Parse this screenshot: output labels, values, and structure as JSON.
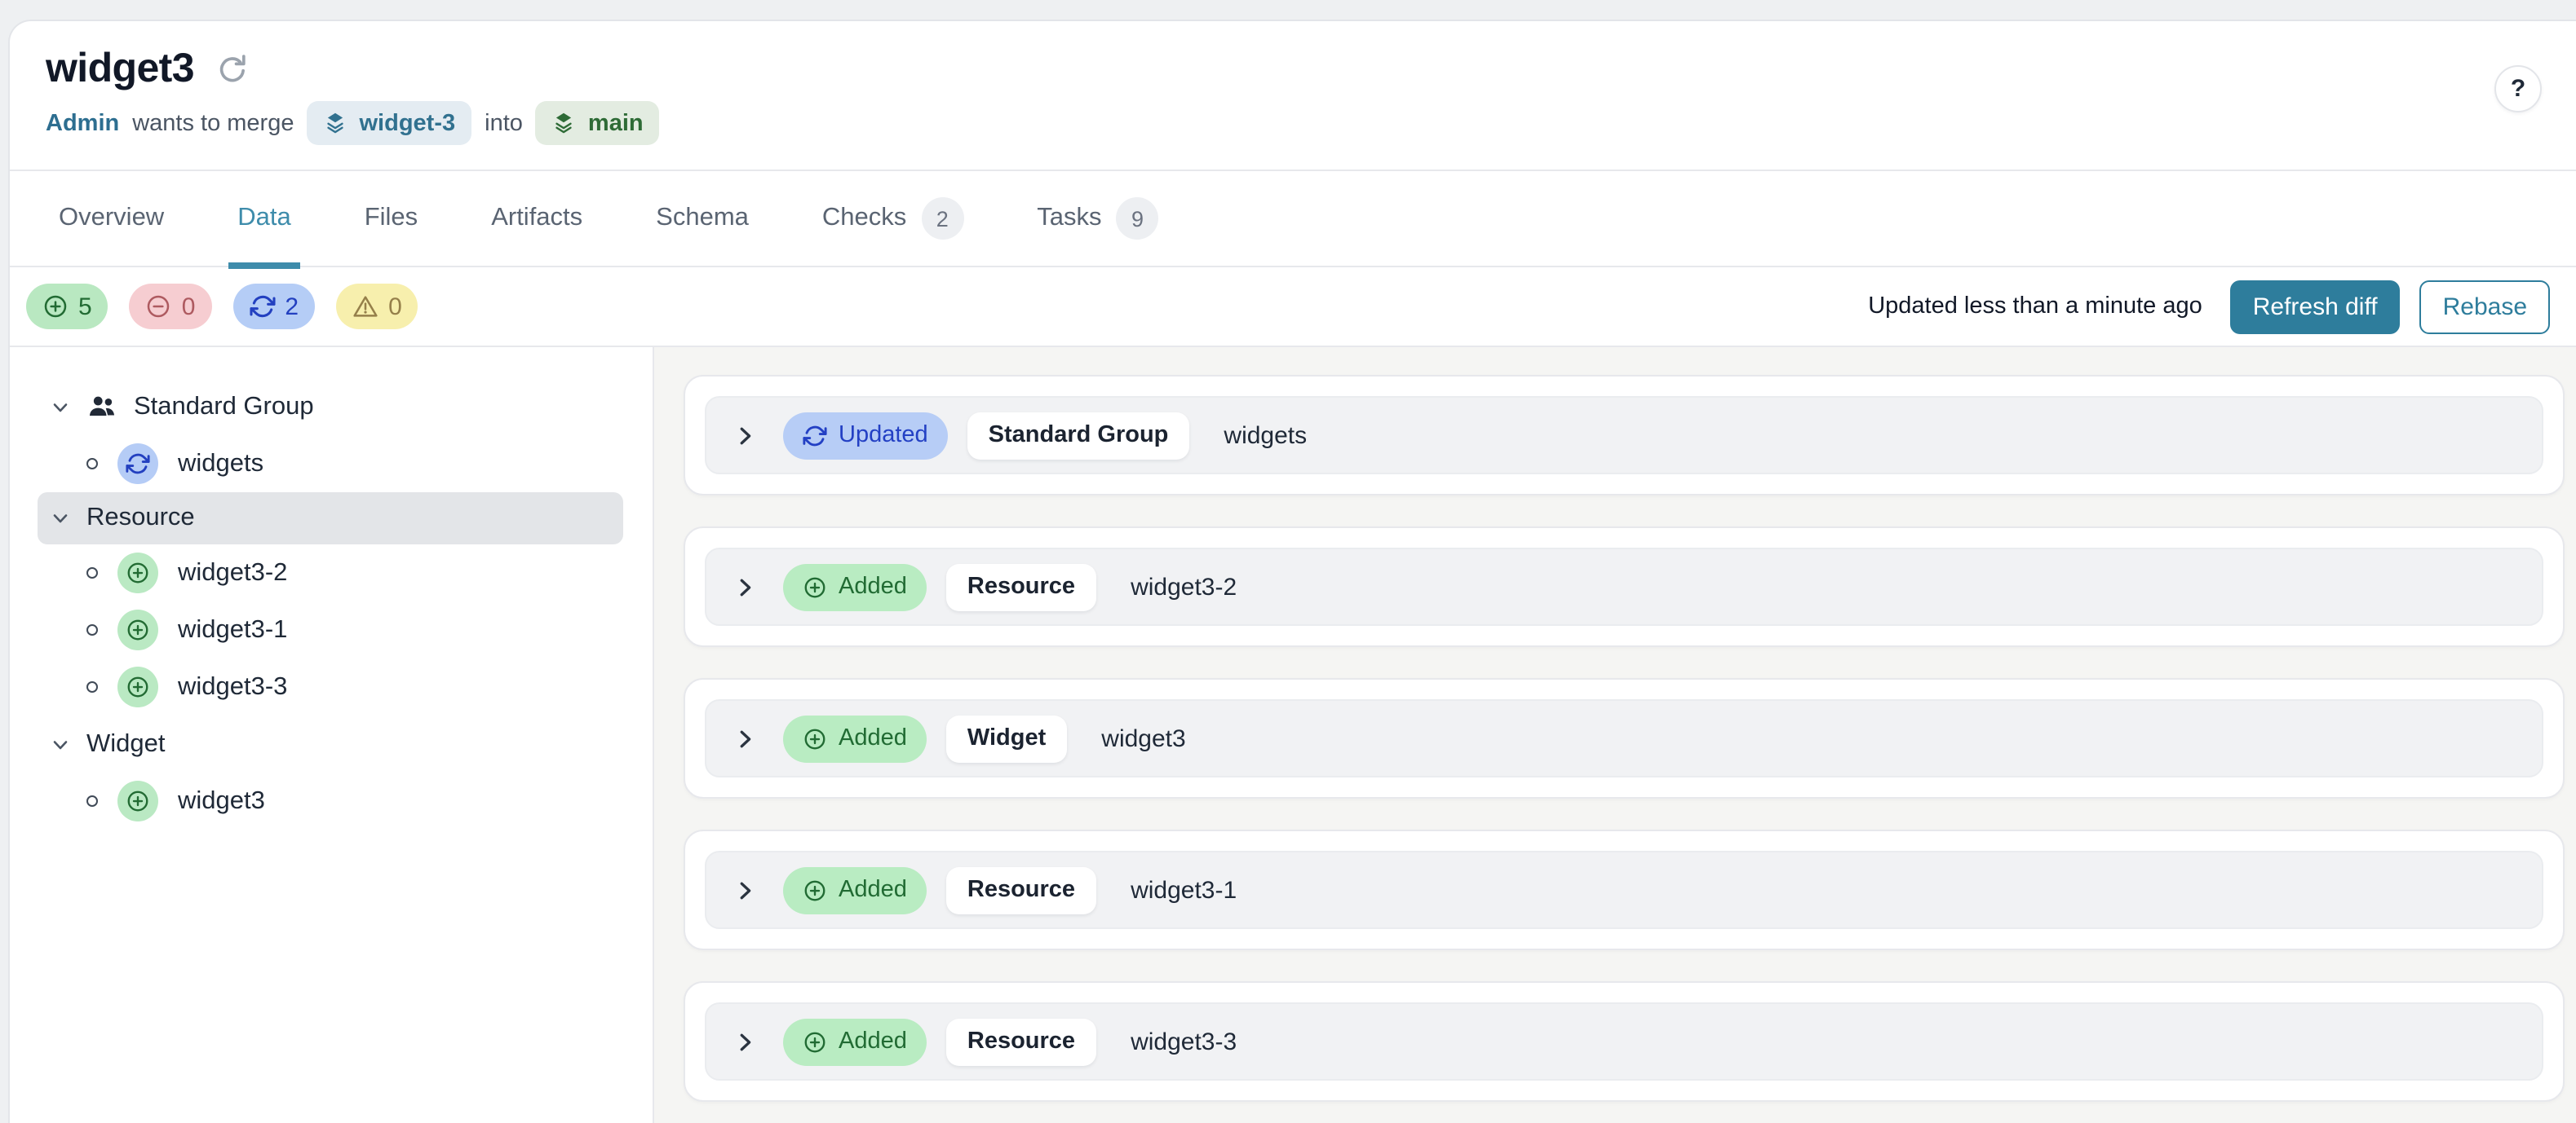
{
  "header": {
    "title": "widget3",
    "refresh_icon": "refresh-icon",
    "author": "Admin",
    "action_text": "wants to merge",
    "source_branch": "widget-3",
    "preposition": "into",
    "target_branch": "main",
    "help_label": "?"
  },
  "tabs": [
    {
      "label": "Overview",
      "active": false
    },
    {
      "label": "Data",
      "active": true
    },
    {
      "label": "Files",
      "active": false
    },
    {
      "label": "Artifacts",
      "active": false
    },
    {
      "label": "Schema",
      "active": false
    },
    {
      "label": "Checks",
      "active": false,
      "count": "2"
    },
    {
      "label": "Tasks",
      "active": false,
      "count": "9"
    }
  ],
  "diff_summary": {
    "stats": [
      {
        "kind": "added",
        "icon": "plus-circle-icon",
        "count": "5"
      },
      {
        "kind": "removed",
        "icon": "minus-circle-icon",
        "count": "0"
      },
      {
        "kind": "updated",
        "icon": "sync-icon",
        "count": "2"
      },
      {
        "kind": "warning",
        "icon": "warning-icon",
        "count": "0"
      }
    ],
    "updated_text": "Updated less than a minute ago",
    "refresh_button": "Refresh diff",
    "rebase_button": "Rebase"
  },
  "sidebar": {
    "tree": [
      {
        "label": "Standard Group",
        "icon": "group-icon",
        "selected": false,
        "children": [
          {
            "label": "widgets",
            "status": "updated"
          }
        ]
      },
      {
        "label": "Resource",
        "icon": null,
        "selected": true,
        "children": [
          {
            "label": "widget3-2",
            "status": "added"
          },
          {
            "label": "widget3-1",
            "status": "added"
          },
          {
            "label": "widget3-3",
            "status": "added"
          }
        ]
      },
      {
        "label": "Widget",
        "icon": null,
        "selected": false,
        "children": [
          {
            "label": "widget3",
            "status": "added"
          }
        ]
      }
    ]
  },
  "diff_rows": [
    {
      "status": "Updated",
      "status_kind": "updated",
      "status_icon": "sync-icon",
      "type": "Standard Group",
      "name": "widgets"
    },
    {
      "status": "Added",
      "status_kind": "added",
      "status_icon": "plus-circle-icon",
      "type": "Resource",
      "name": "widget3-2"
    },
    {
      "status": "Added",
      "status_kind": "added",
      "status_icon": "plus-circle-icon",
      "type": "Widget",
      "name": "widget3"
    },
    {
      "status": "Added",
      "status_kind": "added",
      "status_icon": "plus-circle-icon",
      "type": "Resource",
      "name": "widget3-1"
    },
    {
      "status": "Added",
      "status_kind": "added",
      "status_icon": "plus-circle-icon",
      "type": "Resource",
      "name": "widget3-3"
    }
  ],
  "colors": {
    "accent": "#2e7d9c",
    "tab_active": "#3e8cab",
    "added_bg": "#b9ecc2",
    "added_fg": "#216b33",
    "removed_bg": "#f6cdd1",
    "removed_fg": "#ae5a60",
    "updated_bg": "#b7cdf6",
    "updated_fg": "#2340c4",
    "warning_bg": "#f7efad",
    "warning_fg": "#957f4a",
    "source_branch_bg": "#e4ecf2",
    "source_branch_fg": "#31718f",
    "target_branch_bg": "#e3ece1",
    "target_branch_fg": "#2e6b36"
  }
}
